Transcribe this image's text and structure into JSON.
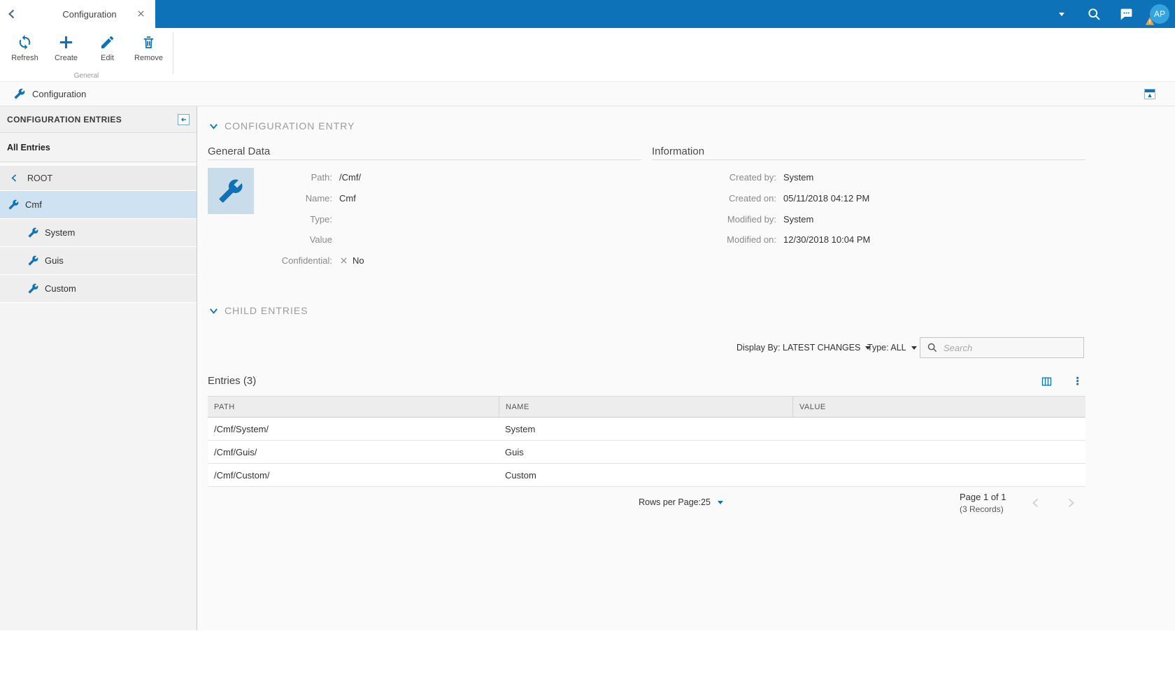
{
  "colors": {
    "primary": "#0e72b8",
    "avatar_blue": "#35a3e0",
    "selected_row": "#cfe2f1",
    "warning_orange": "#eca13f"
  },
  "icons": {
    "back": "chevron-left-icon",
    "tab_close": "x-icon",
    "topbar_menu": "caret-down-icon",
    "search": "magnifier-icon",
    "messages": "speech-bubble-icon",
    "avatar_warning": "warning-triangle-icon",
    "refresh": "sync-arrows-icon",
    "create": "plus-icon",
    "edit": "pencil-icon",
    "remove": "trash-icon",
    "entry": "wrench-icon",
    "collapse_panel": "box-arrow-left-icon",
    "restore_panel": "window-up-arrow-icon",
    "section_toggle": "chevron-down-icon",
    "columns": "table-columns-icon",
    "more": "kebab-dots-icon",
    "confidential_no": "x-mark-icon"
  },
  "topbar": {
    "tab_title": "Configuration",
    "avatar_initials": "AP"
  },
  "toolbar": {
    "buttons": [
      {
        "label": "Refresh"
      },
      {
        "label": "Create"
      },
      {
        "label": "Edit"
      },
      {
        "label": "Remove"
      }
    ],
    "group_label": "General"
  },
  "breadcrumb": {
    "title": "Configuration"
  },
  "sidebar": {
    "header": "CONFIGURATION ENTRIES",
    "all_entries_label": "All Entries",
    "root_label": "ROOT",
    "tree": [
      {
        "label": "Cmf",
        "selected": true
      },
      {
        "label": "System",
        "selected": false
      },
      {
        "label": "Guis",
        "selected": false
      },
      {
        "label": "Custom",
        "selected": false
      }
    ]
  },
  "entry_section": {
    "title": "CONFIGURATION ENTRY",
    "general": {
      "title": "General Data",
      "fields": [
        {
          "label": "Path:",
          "value": "/Cmf/"
        },
        {
          "label": "Name:",
          "value": "Cmf"
        },
        {
          "label": "Type:",
          "value": ""
        },
        {
          "label": "Value",
          "value": ""
        },
        {
          "label": "Confidential:",
          "value": "No",
          "value_icon": "x-mark"
        }
      ]
    },
    "information": {
      "title": "Information",
      "fields": [
        {
          "label": "Created by:",
          "value": "System"
        },
        {
          "label": "Created on:",
          "value": "05/11/2018 04:12 PM"
        },
        {
          "label": "Modified by:",
          "value": "System"
        },
        {
          "label": "Modified on:",
          "value": "12/30/2018 10:04 PM"
        }
      ]
    }
  },
  "child_section": {
    "title": "CHILD ENTRIES",
    "display_by_label": "Display By:",
    "display_by_value": "LATEST CHANGES",
    "type_label": "Type:",
    "type_value": "ALL",
    "search_placeholder": "Search"
  },
  "entries_table": {
    "title": "Entries (3)",
    "columns": [
      "PATH",
      "NAME",
      "VALUE"
    ],
    "rows": [
      [
        "/Cmf/System/",
        "System",
        ""
      ],
      [
        "/Cmf/Guis/",
        "Guis",
        ""
      ],
      [
        "/Cmf/Custom/",
        "Custom",
        ""
      ]
    ]
  },
  "pagination": {
    "rows_per_page_label": "Rows per Page:",
    "rows_per_page_value": "25",
    "page_info": "Page 1 of 1",
    "records_info": "(3 Records)"
  }
}
